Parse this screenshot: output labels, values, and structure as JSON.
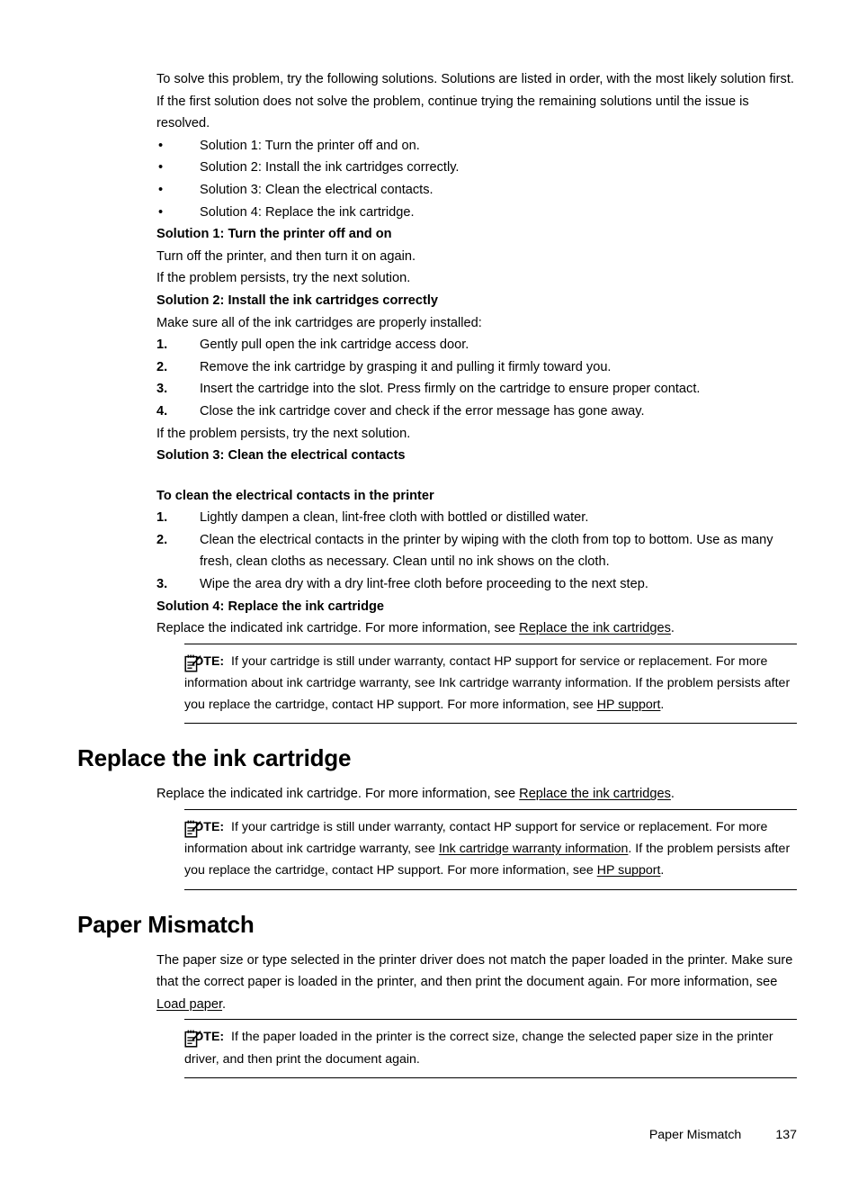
{
  "document": {
    "intro_paragraph": "To solve this problem, try the following solutions. Solutions are listed in order, with the most likely solution first. If the first solution does not solve the problem, continue trying the remaining solutions until the issue is resolved.",
    "solution_list": [
      "Solution 1: Turn the printer off and on.",
      "Solution 2: Install the ink cartridges correctly.",
      "Solution 3: Clean the electrical contacts.",
      "Solution 4: Replace the ink cartridge."
    ],
    "bullet_glyph": "•",
    "solution1": {
      "heading": "Solution 1: Turn the printer off and on",
      "paragraph1": "Turn off the printer, and then turn it on again.",
      "paragraph2": "If the problem persists, try the next solution."
    },
    "solution2": {
      "heading": "Solution 2: Install the ink cartridges correctly",
      "intro": "Make sure all of the ink cartridges are properly installed:",
      "steps": [
        {
          "number": "1.",
          "text": "Gently pull open the ink cartridge access door."
        },
        {
          "number": "2.",
          "text": "Remove the ink cartridge by grasping it and pulling it firmly toward you."
        },
        {
          "number": "3.",
          "text": "Insert the cartridge into the slot. Press firmly on the cartridge to ensure proper contact."
        },
        {
          "number": "4.",
          "text": "Close the ink cartridge cover and check if the error message has gone away."
        }
      ],
      "closing": "If the problem persists, try the next solution."
    },
    "solution3": {
      "heading": "Solution 3: Clean the electrical contacts",
      "procedure_heading": "To clean the electrical contacts in the printer",
      "steps": [
        {
          "number": "1.",
          "text": "Lightly dampen a clean, lint-free cloth with bottled or distilled water."
        },
        {
          "number": "2.",
          "text": "Clean the electrical contacts in the printer by wiping with the cloth from top to bottom. Use as many fresh, clean cloths as necessary. Clean until no ink shows on the cloth."
        },
        {
          "number": "3.",
          "text": "Wipe the area dry with a dry lint-free cloth before proceeding to the next step."
        }
      ]
    },
    "solution4": {
      "heading": "Solution 4: Replace the ink cartridge",
      "paragraph_prefix": "Replace the indicated ink cartridge. For more information, see ",
      "paragraph_link": "Replace the ink cartridges",
      "paragraph_suffix": "."
    },
    "note1": {
      "label": "NOTE:",
      "icon": "note-pencil-icon",
      "seg1": "If your cartridge is still under warranty, contact HP support for service or replacement. For more information about ink cartridge warranty, see ",
      "seg2_plain": "Ink cartridge warranty information",
      "seg3": ". If the problem persists after you replace the cartridge, contact HP support. For more information, see ",
      "seg4_link": "HP support",
      "seg5": "."
    },
    "section_replace": {
      "heading": "Replace the ink cartridge",
      "paragraph_prefix": "Replace the indicated ink cartridge. For more information, see ",
      "paragraph_link": "Replace the ink cartridges",
      "paragraph_suffix": ".",
      "note": {
        "label": "NOTE:",
        "icon": "note-pencil-icon",
        "seg1": "If your cartridge is still under warranty, contact HP support for service or replacement. For more information about ink cartridge warranty, see ",
        "seg2_link": "Ink cartridge warranty information",
        "seg3": ". If the problem persists after you replace the cartridge, contact HP support. For more information, see ",
        "seg4_link": "HP support",
        "seg5": "."
      }
    },
    "section_paper_mismatch": {
      "heading": "Paper Mismatch",
      "paragraph_prefix": "The paper size or type selected in the printer driver does not match the paper loaded in the printer. Make sure that the correct paper is loaded in the printer, and then print the document again. For more information, see ",
      "paragraph_link": "Load paper",
      "paragraph_suffix": ".",
      "note": {
        "label": "NOTE:",
        "icon": "note-pencil-icon",
        "text": "If the paper loaded in the printer is the correct size, change the selected paper size in the printer driver, and then print the document again."
      }
    },
    "footer": {
      "section_title": "Paper Mismatch",
      "page_number": "137"
    }
  }
}
